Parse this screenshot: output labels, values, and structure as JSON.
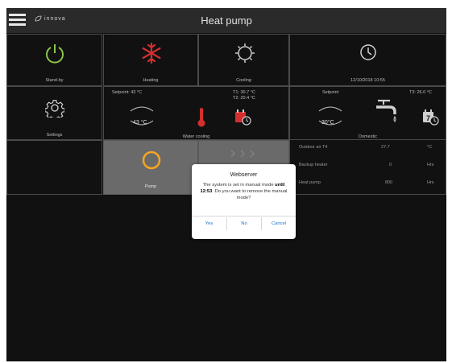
{
  "header": {
    "title": "Heat pump",
    "brand": "innova",
    "menu_icon": "hamburger-menu-icon"
  },
  "tiles": {
    "standby": {
      "label": "Stand-by",
      "icon": "power-icon",
      "color": "#8bc34a"
    },
    "heating": {
      "label": "Heating",
      "icon": "snowflake-icon",
      "color": "#d32f2f"
    },
    "cooling": {
      "label": "Cooling",
      "icon": "sun-gear-icon"
    },
    "datetime": {
      "value": "12/10/2018 10:55",
      "icon": "clock-icon"
    },
    "settings": {
      "label": "Settings",
      "icon": "gear-icon"
    },
    "water_cooling": {
      "setpoint_label": "Setpoint: 43 °C",
      "setpoint_value": "43 °C",
      "t1": "T1: 30.7 °C",
      "t2": "T2: 20.4 °C",
      "label": "Water cooling",
      "thermometer_color": "#d32f2f"
    },
    "domestic": {
      "setpoint_label": "Setpoint",
      "t3": "T3: 26.0 °C",
      "setpoint_value": "30°C",
      "label": "Domestic",
      "calendar_day": "7"
    },
    "pump": {
      "label": "Pump",
      "icon": "pump-ring-icon",
      "color": "#f5a623"
    }
  },
  "readouts": [
    {
      "name": "Outdoor air T4",
      "value": "27.7",
      "unit": "°C"
    },
    {
      "name": "Backup heater",
      "value": "0",
      "unit": "Hrs"
    },
    {
      "name": "Heat pump",
      "value": "800",
      "unit": "Hrs"
    }
  ],
  "dialog": {
    "title": "Webserver",
    "msg_part1": "The system is set in manual mode ",
    "msg_until": "until 12:53",
    "msg_part2": ". Do you want to remove the manual mode?",
    "yes": "Yes",
    "no": "No",
    "cancel": "Cancel",
    "accent": "#1b6fd1"
  }
}
